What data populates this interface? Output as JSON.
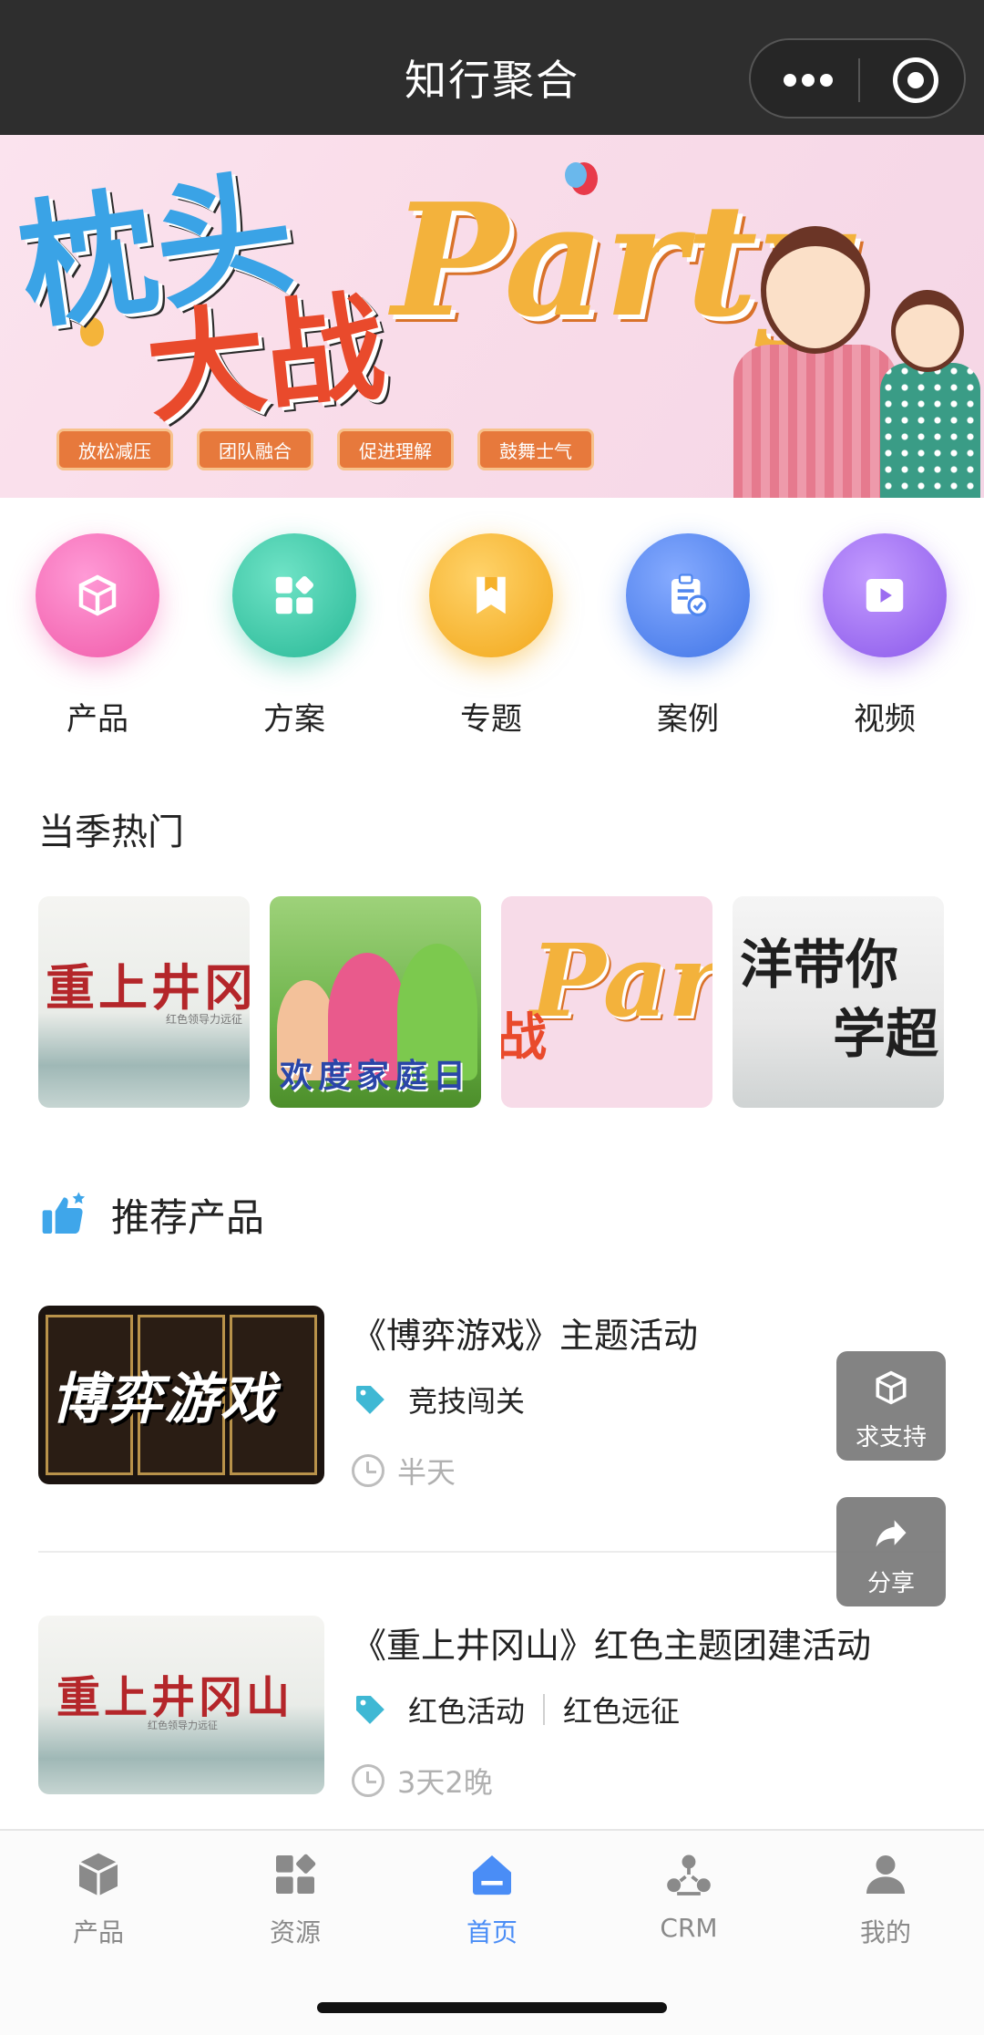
{
  "app": {
    "title": "知行聚合"
  },
  "banner": {
    "headline_1": "枕头",
    "headline_2": "大战",
    "headline_3": "Party",
    "tags": [
      "放松减压",
      "团队融合",
      "促进理解",
      "鼓舞士气"
    ]
  },
  "categories": [
    {
      "label": "产品",
      "icon": "cube-icon",
      "color": "#f56fb8"
    },
    {
      "label": "方案",
      "icon": "grid-icon",
      "color": "#37c9a7"
    },
    {
      "label": "专题",
      "icon": "bookmark-icon",
      "color": "#f7b52e"
    },
    {
      "label": "案例",
      "icon": "clipboard-check-icon",
      "color": "#4f86ef"
    },
    {
      "label": "视频",
      "icon": "play-icon",
      "color": "#a070f0"
    }
  ],
  "hot": {
    "title": "当季热门",
    "cards": [
      {
        "line1": "重上井冈山",
        "line2": "红色领导力远征"
      },
      {
        "line1": "欢度家庭日"
      },
      {
        "line1": "Party",
        "line2": "战"
      },
      {
        "line1": "洋带你",
        "line2": "学超"
      }
    ]
  },
  "recommended": {
    "title": "推荐产品",
    "products": [
      {
        "name": "《博弈游戏》主题活动",
        "thumb_text": "博弈游戏",
        "tags": [
          "竞技闯关"
        ],
        "duration": "半天"
      },
      {
        "name": "《重上井冈山》红色主题团建活动",
        "thumb_text": "重上井冈山",
        "thumb_sub": "红色领导力远征",
        "tags": [
          "红色活动",
          "红色远征"
        ],
        "duration": "3天2晚"
      }
    ]
  },
  "floating": {
    "support": "求支持",
    "share": "分享"
  },
  "tabbar": {
    "items": [
      {
        "label": "产品",
        "icon": "cube-icon"
      },
      {
        "label": "资源",
        "icon": "grid-icon"
      },
      {
        "label": "首页",
        "icon": "home-icon",
        "active": true
      },
      {
        "label": "CRM",
        "icon": "crm-icon"
      },
      {
        "label": "我的",
        "icon": "user-icon"
      }
    ]
  },
  "colors": {
    "accent": "#4a8df6",
    "navbar": "#2e2e2e",
    "tag_icon": "#3fb8d4"
  }
}
